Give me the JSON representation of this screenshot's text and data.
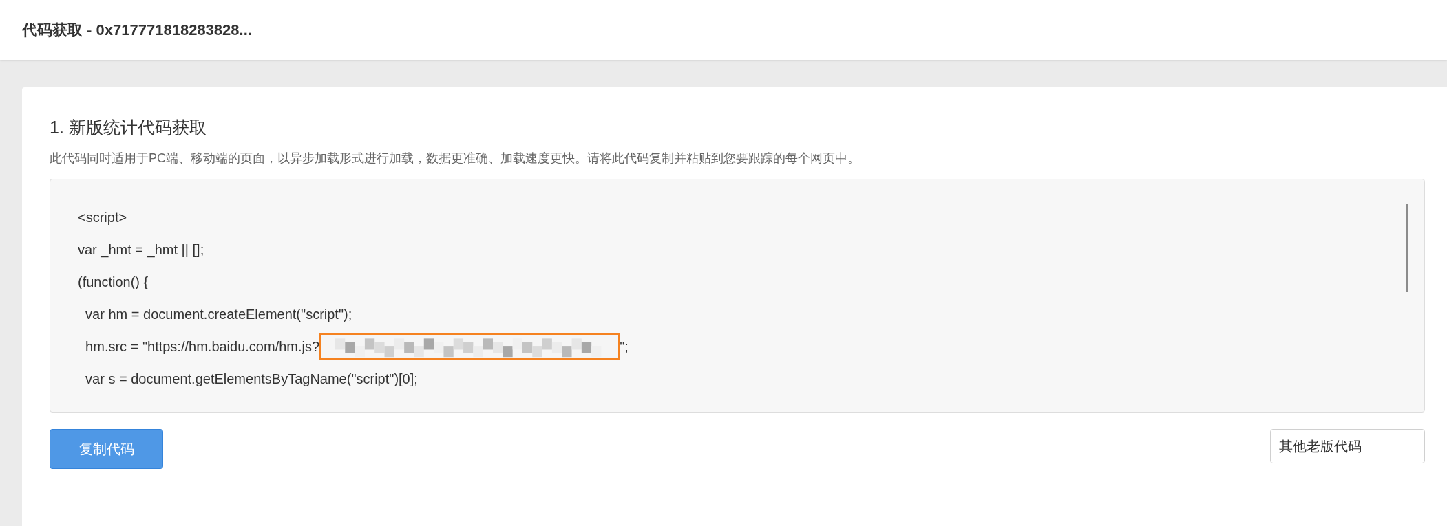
{
  "header": {
    "title": "代码获取 - 0x717771818283828..."
  },
  "section": {
    "heading": "1. 新版统计代码获取",
    "description": "此代码同时适用于PC端、移动端的页面，以异步加载形式进行加载，数据更准确、加载速度更快。请将此代码复制并粘贴到您要跟踪的每个网页中。",
    "code_lines": [
      {
        "kind": "plain",
        "text": "<script>"
      },
      {
        "kind": "plain",
        "text": "var _hmt = _hmt || [];"
      },
      {
        "kind": "plain",
        "text": "(function() {"
      },
      {
        "kind": "plain",
        "text": "  var hm = document.createElement(\"script\");"
      },
      {
        "kind": "redacted",
        "text": "  hm.src = \"https://hm.baidu.com/hm.js?",
        "after": "\";"
      },
      {
        "kind": "plain",
        "text": "  var s = document.getElementsByTagName(\"script\")[0];"
      }
    ]
  },
  "buttons": {
    "copy": "复制代码",
    "other": "其他老版代码"
  }
}
